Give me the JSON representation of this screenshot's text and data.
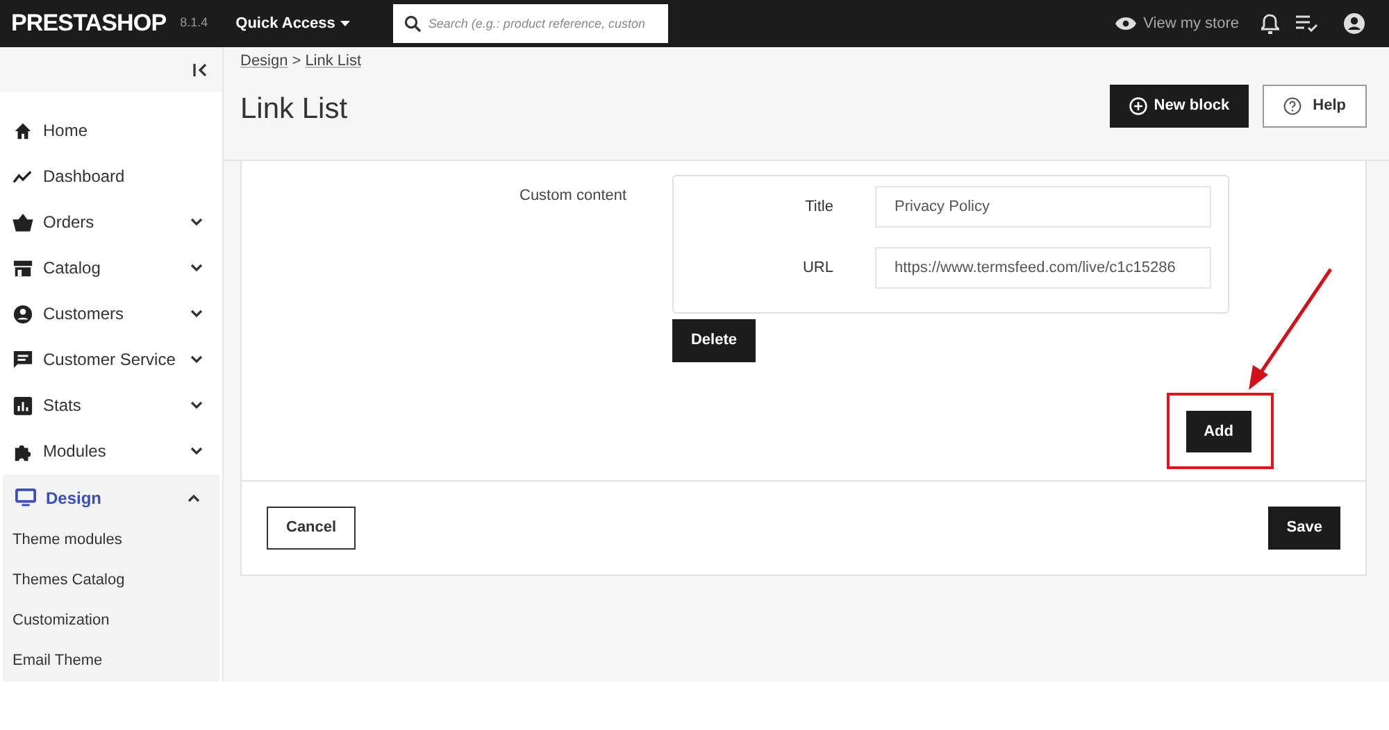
{
  "topbar": {
    "logo": "PRESTASHOP",
    "version": "8.1.4",
    "quick_access": "Quick Access",
    "search": {
      "placeholder": "Search (e.g.: product reference, custon"
    },
    "view_store": "View my store"
  },
  "sidebar": {
    "items": [
      {
        "label": "Home",
        "selected": false
      },
      {
        "label": "Dashboard",
        "selected": false
      },
      {
        "label": "Orders",
        "selected": false,
        "expanded": false
      },
      {
        "label": "Catalog",
        "selected": false,
        "expanded": false
      },
      {
        "label": "Customers",
        "selected": false,
        "expanded": false
      },
      {
        "label": "Customer Service",
        "selected": false,
        "expanded": false
      },
      {
        "label": "Stats",
        "selected": false,
        "expanded": false
      },
      {
        "label": "Modules",
        "selected": false,
        "expanded": false
      },
      {
        "label": "Design",
        "selected": true,
        "expanded": true,
        "children": [
          {
            "label": "Theme modules"
          },
          {
            "label": "Themes Catalog"
          },
          {
            "label": "Customization"
          },
          {
            "label": "Email Theme"
          }
        ]
      }
    ]
  },
  "header": {
    "breadcrumb": [
      "Design",
      "Link List"
    ],
    "breadcrumb_separator": ">",
    "title": "Link List",
    "buttons": [
      {
        "label": "New block",
        "kind": "primary"
      },
      {
        "label": "Help",
        "kind": "outline"
      }
    ]
  },
  "form": {
    "section_label": "Custom content",
    "fields": [
      {
        "label": "Title",
        "value": "Privacy Policy"
      },
      {
        "label": "URL",
        "value": "https://www.termsfeed.com/live/c1c15286"
      }
    ],
    "delete": "Delete",
    "add": "Add",
    "add_highlighted": true,
    "cancel": "Cancel",
    "save": "Save"
  }
}
